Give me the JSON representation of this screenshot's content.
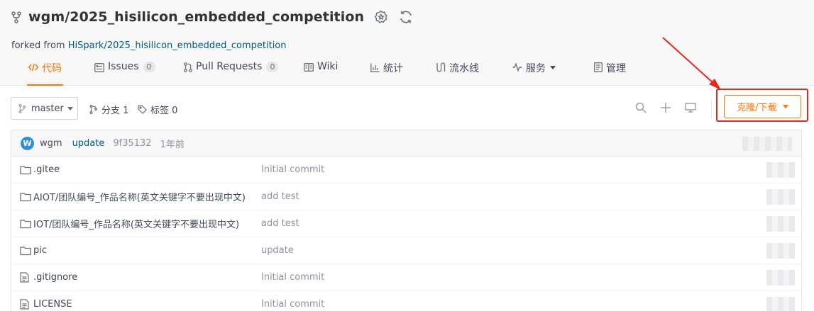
{
  "repo": {
    "title": "wgm/2025_hisilicon_embedded_competition",
    "forked_prefix": "forked from ",
    "forked_from": "HiSpark/2025_hisilicon_embedded_competition"
  },
  "tabs": [
    {
      "label": "代码",
      "icon": "code-icon",
      "active": true
    },
    {
      "label": "Issues",
      "icon": "issues-icon",
      "count": "0"
    },
    {
      "label": "Pull Requests",
      "icon": "pull-request-icon",
      "count": "0"
    },
    {
      "label": "Wiki",
      "icon": "wiki-icon"
    },
    {
      "label": "统计",
      "icon": "stats-icon"
    },
    {
      "label": "流水线",
      "icon": "pipeline-icon"
    },
    {
      "label": "服务",
      "icon": "service-icon",
      "dropdown": true
    },
    {
      "label": "管理",
      "icon": "manage-icon"
    }
  ],
  "toolbar": {
    "branch": "master",
    "branches_label": "分支 1",
    "tags_label": "标签 0",
    "clone_label": "克隆/下载"
  },
  "commit": {
    "avatar_letter": "W",
    "author": "wgm",
    "message": "update",
    "sha": "9f35132",
    "time": "1年前"
  },
  "files": [
    {
      "type": "folder",
      "name": ".gitee",
      "message": "Initial commit"
    },
    {
      "type": "folder",
      "name": "AIOT/团队编号_作品名称(英文关键字不要出现中文)",
      "message": "add test"
    },
    {
      "type": "folder",
      "name": "IOT/团队编号_作品名称(英文关键字不要出现中文)",
      "message": "add test"
    },
    {
      "type": "folder",
      "name": "pic",
      "message": "update"
    },
    {
      "type": "file",
      "name": ".gitignore",
      "message": "Initial commit"
    },
    {
      "type": "file",
      "name": "LICENSE",
      "message": "Initial commit"
    }
  ],
  "colors": {
    "accent": "#fe7300",
    "link": "#005980",
    "annotation": "#e8271e"
  }
}
